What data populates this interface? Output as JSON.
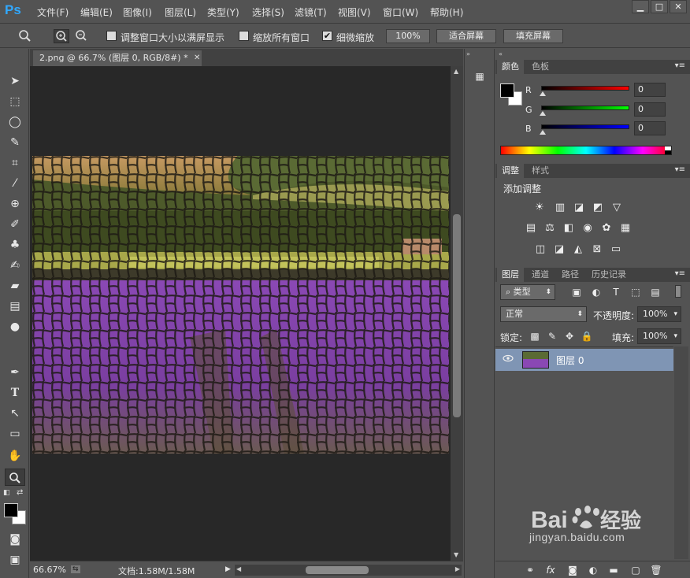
{
  "app": {
    "logo": "Ps"
  },
  "menu": [
    "文件(F)",
    "编辑(E)",
    "图像(I)",
    "图层(L)",
    "类型(Y)",
    "选择(S)",
    "滤镜(T)",
    "视图(V)",
    "窗口(W)",
    "帮助(H)"
  ],
  "window_controls": {
    "minimize": "▁",
    "maximize": "□",
    "close": "✕"
  },
  "options": {
    "resize_windows": "调整窗口大小以满屏显示",
    "zoom_all": "缩放所有窗口",
    "scrubby_zoom": "细微缩放",
    "zoom_100": "100%",
    "fit_screen": "适合屏幕",
    "fill_screen": "填充屏幕",
    "resize_checked": false,
    "zoom_all_checked": false,
    "scrubby_checked": true
  },
  "document": {
    "tab_title": "2.png @ 66.7% (图层 0, RGB/8#) *",
    "zoom_status": "66.67%",
    "doc_size": "文档:1.58M/1.58M"
  },
  "color_panel": {
    "tabs": [
      "颜色",
      "色板"
    ],
    "channels": [
      {
        "label": "R",
        "value": "0"
      },
      {
        "label": "G",
        "value": "0"
      },
      {
        "label": "B",
        "value": "0"
      }
    ],
    "foreground": "#000000",
    "background": "#ffffff"
  },
  "adjustments_panel": {
    "tabs": [
      "调整",
      "样式"
    ],
    "heading": "添加调整"
  },
  "layers_panel": {
    "tabs": [
      "图层",
      "通道",
      "路径",
      "历史记录"
    ],
    "filter_kind": "类型",
    "blend_mode": "正常",
    "opacity_label": "不透明度:",
    "opacity_value": "100%",
    "lock_label": "锁定:",
    "fill_label": "填充:",
    "fill_value": "100%",
    "layers": [
      {
        "name": "图层 0",
        "visible": true,
        "selected": true
      }
    ]
  },
  "watermark": {
    "brand": "Baidu经验",
    "url": "jingyan.baidu.com"
  }
}
